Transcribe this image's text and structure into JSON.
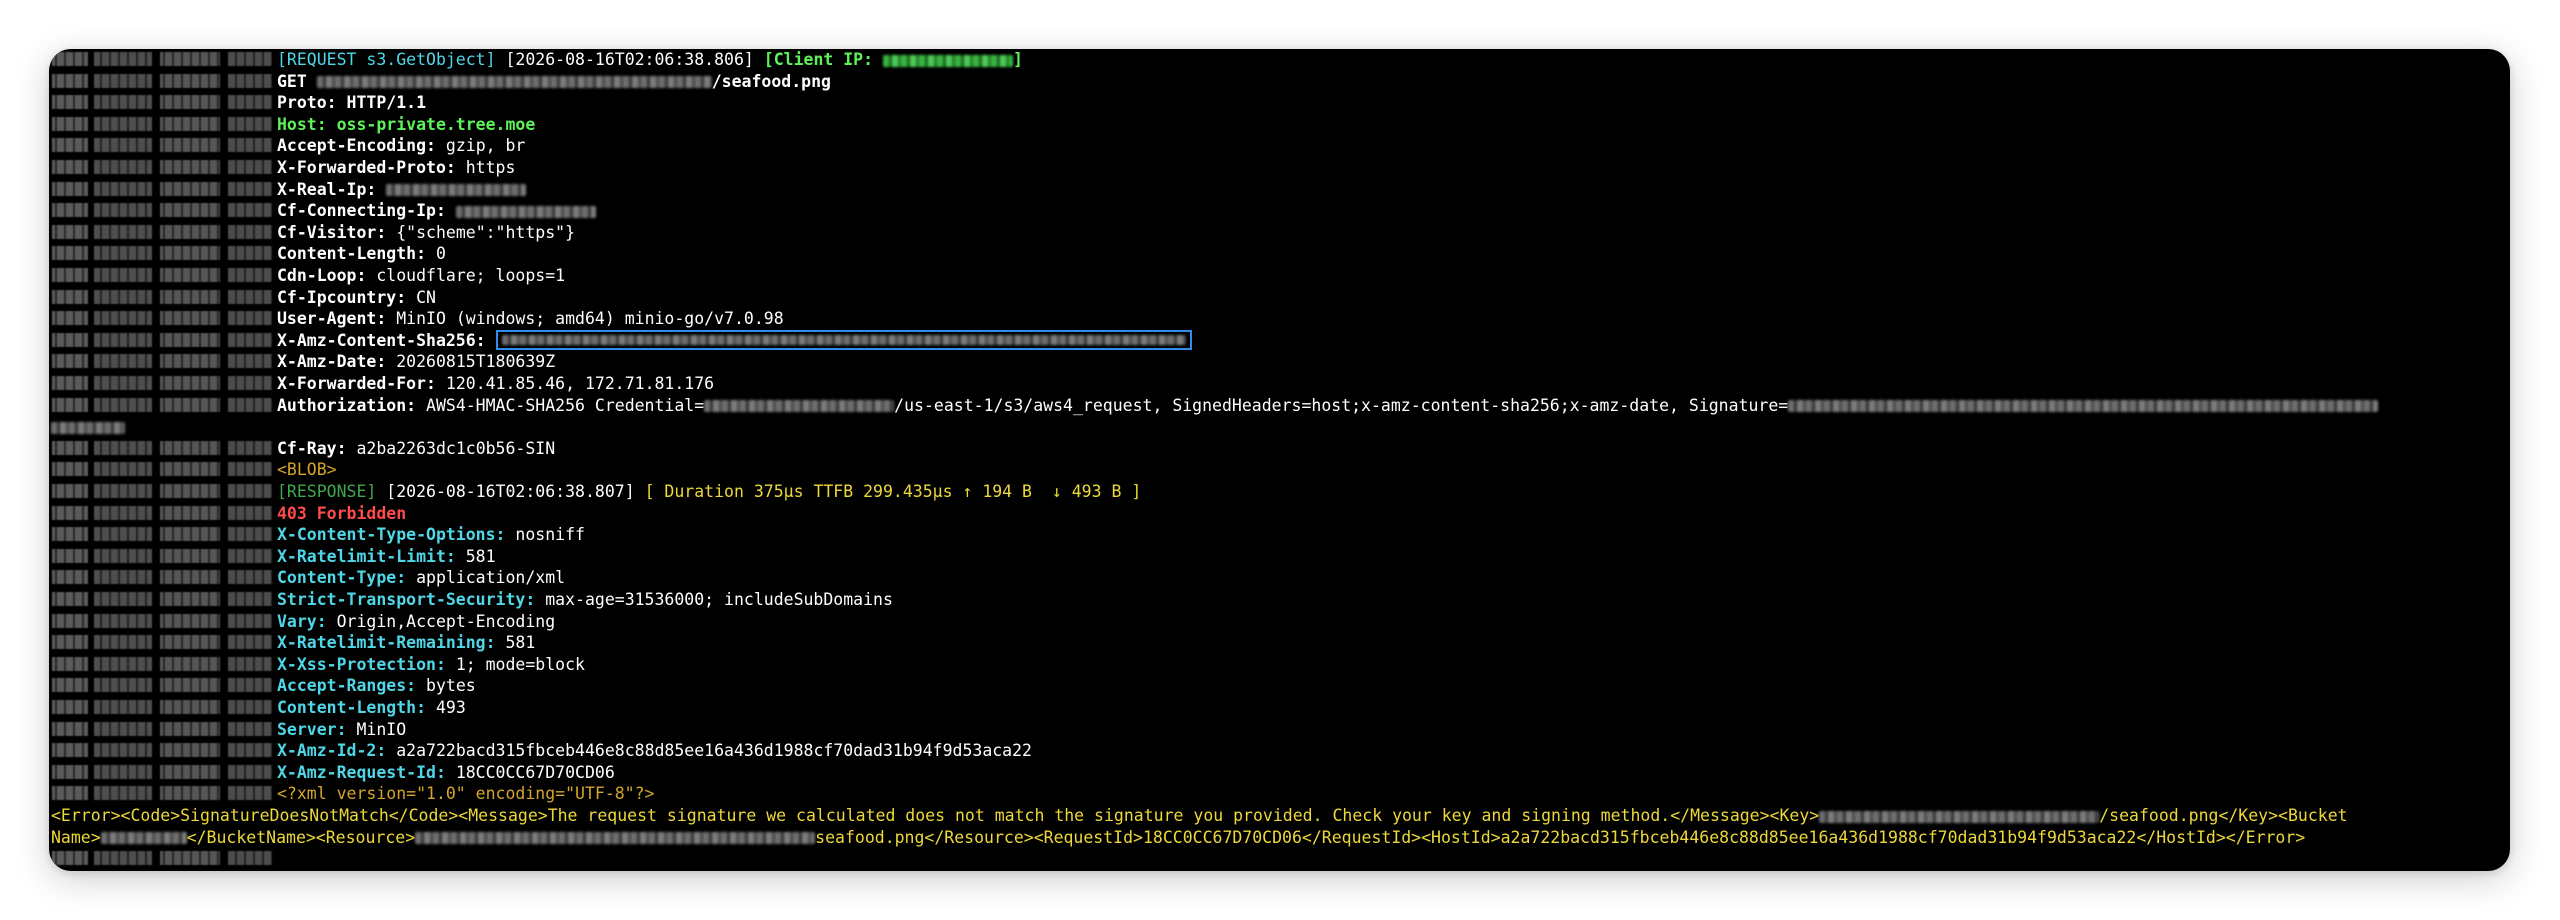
{
  "terminal": {
    "request_header": {
      "tag": "[REQUEST s3.GetObject]",
      "timestamp": "[2026-08-16T02:06:38.806]",
      "client_ip_label": "[Client IP:",
      "client_ip_close": "]"
    },
    "request_line": {
      "method": "GET ",
      "path_suffix": "/seafood.png"
    },
    "request_headers": {
      "proto": {
        "key": "Proto: ",
        "value": "HTTP/1.1"
      },
      "host": {
        "text": "Host: oss-private.tree.moe"
      },
      "accept_encoding": {
        "key": "Accept-Encoding: ",
        "value": "gzip, br"
      },
      "x_forwarded_proto": {
        "key": "X-Forwarded-Proto: ",
        "value": "https"
      },
      "x_real_ip": {
        "key": "X-Real-Ip: "
      },
      "cf_connecting_ip": {
        "key": "Cf-Connecting-Ip: "
      },
      "cf_visitor": {
        "key": "Cf-Visitor: ",
        "value": "{\"scheme\":\"https\"}"
      },
      "content_length": {
        "key": "Content-Length: ",
        "value": "0"
      },
      "cdn_loop": {
        "key": "Cdn-Loop: ",
        "value": "cloudflare; loops=1"
      },
      "cf_ipcountry": {
        "key": "Cf-Ipcountry: ",
        "value": "CN"
      },
      "user_agent": {
        "key": "User-Agent: ",
        "value": "MinIO (windows; amd64) minio-go/v7.0.98"
      },
      "x_amz_content_sha256": {
        "key": "X-Amz-Content-Sha256: "
      },
      "x_amz_date": {
        "key": "X-Amz-Date: ",
        "value": "20260815T180639Z"
      },
      "x_forwarded_for": {
        "key": "X-Forwarded-For: ",
        "value": "120.41.85.46, 172.71.81.176"
      },
      "authorization": {
        "key": "Authorization: ",
        "value_a": "AWS4-HMAC-SHA256 Credential=",
        "value_b": "/us-east-1/s3/aws4_request, SignedHeaders=host;x-amz-content-sha256;x-amz-date, Signature="
      },
      "cf_ray": {
        "key": "Cf-Ray: ",
        "value": "a2ba2263dc1c0b56-SIN"
      }
    },
    "blob": "<BLOB>",
    "response_header": {
      "tag": "[RESPONSE]",
      "timestamp": " [2026-08-16T02:06:38.807] ",
      "stats": "[ Duration 375µs TTFB 299.435µs ↑ 194 B  ↓ 493 B ]"
    },
    "status": "403 Forbidden",
    "response_headers": [
      {
        "key": "X-Content-Type-Options: ",
        "value": "nosniff"
      },
      {
        "key": "X-Ratelimit-Limit: ",
        "value": "581"
      },
      {
        "key": "Content-Type: ",
        "value": "application/xml"
      },
      {
        "key": "Strict-Transport-Security: ",
        "value": "max-age=31536000; includeSubDomains"
      },
      {
        "key": "Vary: ",
        "value": "Origin,Accept-Encoding"
      },
      {
        "key": "X-Ratelimit-Remaining: ",
        "value": "581"
      },
      {
        "key": "X-Xss-Protection: ",
        "value": "1; mode=block"
      },
      {
        "key": "Accept-Ranges: ",
        "value": "bytes"
      },
      {
        "key": "Content-Length: ",
        "value": "493"
      },
      {
        "key": "Server: ",
        "value": "MinIO"
      },
      {
        "key": "X-Amz-Id-2: ",
        "value": "a2a722bacd315fbceb446e8c88d85ee16a436d1988cf70dad31b94f9d53aca22"
      },
      {
        "key": "X-Amz-Request-Id: ",
        "value": "18CC0CC67D70CD06"
      }
    ],
    "xml_decl": "<?xml version=\"1.0\" encoding=\"UTF-8\"?>",
    "xml_line1_a": "<Error><Code>SignatureDoesNotMatch</Code><Message>The request signature we calculated does not match the signature you provided. Check your key and signing method.</Message><Key>",
    "xml_line1_b": "/seafood.png</Key><Bucket",
    "xml_line2_a": "Name>",
    "xml_line2_b": "</BucketName><Resource>",
    "xml_line2_c": "seafood.png</Resource><RequestId>18CC0CC67D70CD06</RequestId><HostId>a2a722bacd315fbceb446e8c88d85ee16a436d1988cf70dad31b94f9d53aca22</HostId></Error>",
    "colors": {
      "background": "#000000",
      "header_key": "#4fd7e8",
      "host": "#5ef25a",
      "blob": "#d4a52a",
      "status_error": "#ff4b4b",
      "xml": "#ecd83a",
      "selection_box": "#2f8fe8"
    }
  }
}
